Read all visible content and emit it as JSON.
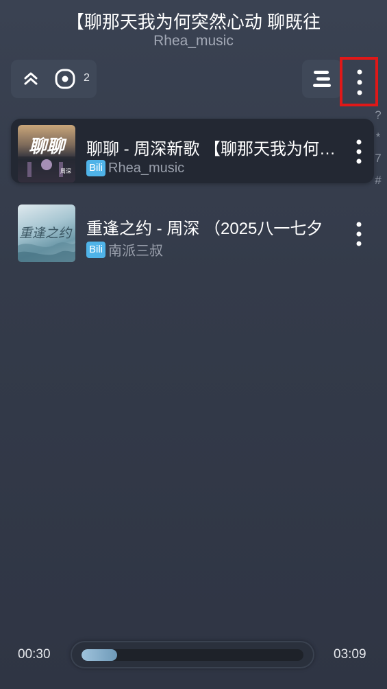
{
  "now_playing": {
    "title": "【聊那天我为何突然心动 聊既往",
    "artist": "Rhea_music"
  },
  "toolbar": {
    "queue_count": "2",
    "icons": {
      "collapse": "double-chevron-up-icon",
      "locate": "locate-current-icon",
      "sort": "list-sort-icon",
      "more": "more-vertical-icon"
    }
  },
  "index_bar": [
    "?",
    "*",
    "7",
    "#"
  ],
  "playlist": [
    {
      "title": "聊聊 - 周深新歌 【聊那天我为何突然心动 聊既往",
      "source_badge": "Bili",
      "artist": "Rhea_music",
      "cover_text": "聊聊",
      "cover_subtext": "周深",
      "active": true
    },
    {
      "title": "重逢之约 - 周深 （2025八一七夕",
      "source_badge": "Bili",
      "artist": "南派三叔",
      "cover_text": "重逢之约",
      "active": false
    }
  ],
  "player": {
    "current_time": "00:30",
    "total_time": "03:09",
    "progress_percent": 16
  },
  "colors": {
    "background": "#343b4a",
    "active_row": "#232833",
    "badge": "#4fb3e8",
    "highlight": "#e01818"
  }
}
